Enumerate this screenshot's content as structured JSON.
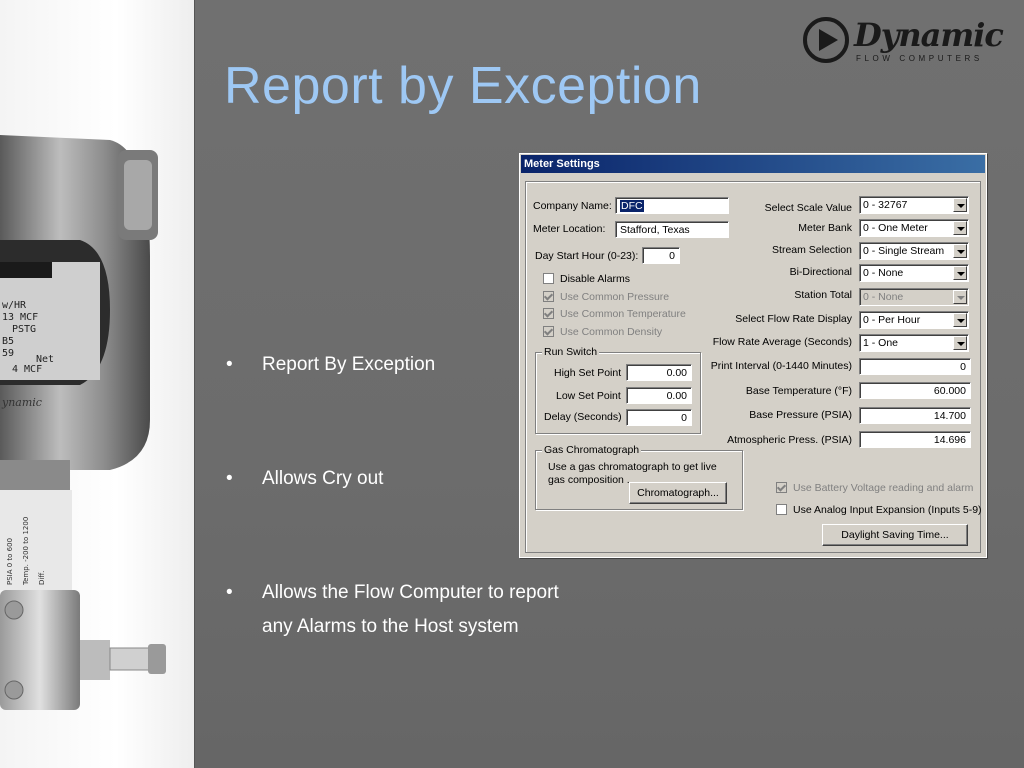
{
  "slide": {
    "title": "Report by Exception",
    "bullets": [
      {
        "symbol": "•",
        "lines": [
          "Report By Exception"
        ]
      },
      {
        "symbol": "•",
        "lines": [
          "Allows Cry out"
        ]
      },
      {
        "symbol": "•",
        "lines": [
          "Allows the Flow Computer to report",
          "any Alarms to the Host system"
        ]
      }
    ],
    "title_color": "#9ec8f4",
    "background_color": "#6e6e6e"
  },
  "logo": {
    "brand": "Dynamic",
    "tagline": "FLOW COMPUTERS",
    "icon": "play-circle-icon"
  },
  "illustration": {
    "icon": "pressure-transmitter-photo",
    "display_lines": [
      "w/HR",
      "13 MCF",
      "PSTG",
      "B5",
      "59",
      "Net",
      "4 MCF"
    ],
    "brand_text": "ynamic",
    "label_lines": [
      "PSIA 0 to 600",
      "Temp. -200 to 1200",
      "Diff."
    ]
  },
  "dialog": {
    "title": "Meter Settings",
    "company_name": {
      "label": "Company Name:",
      "value": "DFC"
    },
    "meter_location": {
      "label": "Meter Location:",
      "value": "Stafford, Texas"
    },
    "day_start_hour": {
      "label": "Day Start Hour (0-23):",
      "value": "0"
    },
    "checkboxes": [
      {
        "label": "Disable Alarms",
        "checked": false,
        "enabled": true
      },
      {
        "label": "Use Common Pressure",
        "checked": true,
        "enabled": false
      },
      {
        "label": "Use Common Temperature",
        "checked": true,
        "enabled": false
      },
      {
        "label": "Use Common Density",
        "checked": true,
        "enabled": false
      }
    ],
    "run_switch": {
      "title": "Run Switch",
      "high_set_point": {
        "label": "High Set Point",
        "value": "0.00"
      },
      "low_set_point": {
        "label": "Low Set Point",
        "value": "0.00"
      },
      "delay": {
        "label": "Delay (Seconds)",
        "value": "0"
      }
    },
    "gas_chromatograph": {
      "title": "Gas Chromatograph",
      "description": "Use a gas chromatograph to get live gas composition .",
      "button": "Chromatograph..."
    },
    "combos": [
      {
        "label": "Select Scale Value",
        "value": "0 - 32767",
        "enabled": true
      },
      {
        "label": "Meter Bank",
        "value": "0 - One Meter",
        "enabled": true
      },
      {
        "label": "Stream Selection",
        "value": "0 - Single Stream",
        "enabled": true
      },
      {
        "label": "Bi-Directional",
        "value": "0 - None",
        "enabled": true
      },
      {
        "label": "Station Total",
        "value": "0 - None",
        "enabled": false
      },
      {
        "label": "Select Flow Rate Display",
        "value": "0 - Per Hour",
        "enabled": true
      },
      {
        "label": "Flow Rate Average (Seconds)",
        "value": "1 - One",
        "enabled": true
      }
    ],
    "numeric_fields": [
      {
        "label": "Print Interval (0-1440 Minutes)",
        "value": "0"
      },
      {
        "label": "Base Temperature (°F)",
        "value": "60.000"
      },
      {
        "label": "Base Pressure (PSIA)",
        "value": "14.700"
      },
      {
        "label": "Atmospheric Press. (PSIA)",
        "value": "14.696"
      }
    ],
    "battery_voltage": {
      "label": "Use Battery Voltage reading and alarm",
      "checked": true,
      "enabled": false
    },
    "analog_expansion": {
      "label": "Use Analog Input Expansion (Inputs 5-9)",
      "checked": false,
      "enabled": true
    },
    "daylight_button": "Daylight Saving Time..."
  }
}
